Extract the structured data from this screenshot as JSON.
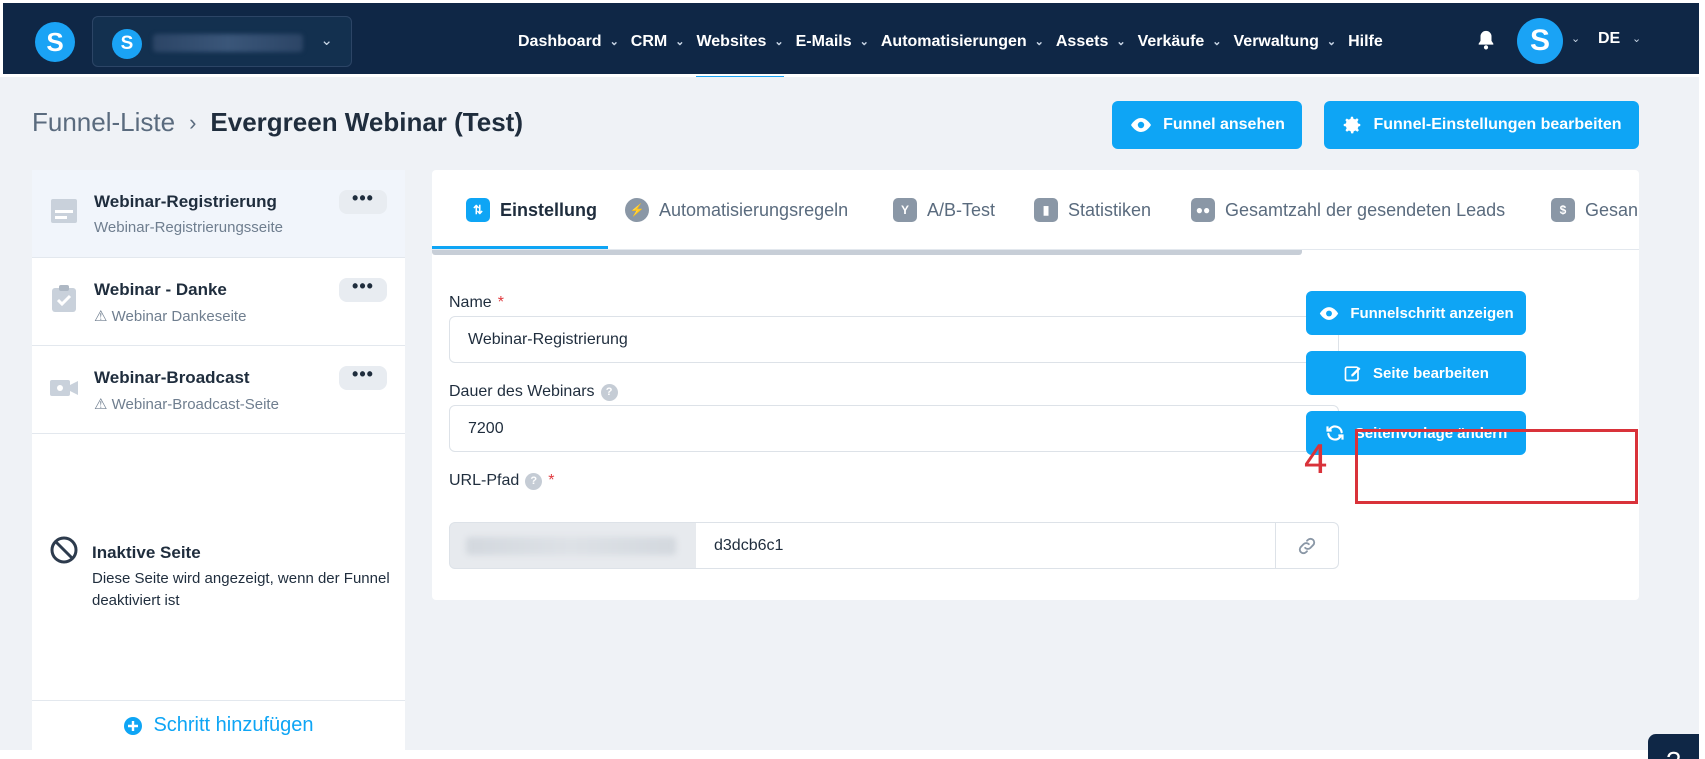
{
  "brand": {
    "logo_letter": "S",
    "accent": "#0ea5f5",
    "navbar_bg": "#0f2746"
  },
  "account_switcher": {
    "letter": "S"
  },
  "nav": {
    "items": [
      {
        "label": "Dashboard",
        "has_caret": true
      },
      {
        "label": "CRM",
        "has_caret": true
      },
      {
        "label": "Websites",
        "has_caret": true,
        "active": true
      },
      {
        "label": "E-Mails",
        "has_caret": true
      },
      {
        "label": "Automatisierungen",
        "has_caret": true
      },
      {
        "label": "Assets",
        "has_caret": true
      },
      {
        "label": "Verkäufe",
        "has_caret": true
      },
      {
        "label": "Verwaltung",
        "has_caret": true
      },
      {
        "label": "Hilfe",
        "has_caret": false
      }
    ],
    "avatar_letter": "S",
    "language": "DE",
    "caret": "⌄"
  },
  "breadcrumb": {
    "parent": "Funnel-Liste",
    "separator": "›",
    "current": "Evergreen Webinar (Test)"
  },
  "header_buttons": {
    "view_funnel": "Funnel ansehen",
    "edit_settings": "Funnel-Einstellungen bearbeiten"
  },
  "steps": [
    {
      "title": "Webinar-Registrierung",
      "subtitle": "Webinar-Registrierungsseite",
      "warning": false,
      "active": true,
      "more": "•••"
    },
    {
      "title": "Webinar - Danke",
      "subtitle": "Webinar Dankeseite",
      "warning": true,
      "active": false,
      "more": "•••"
    },
    {
      "title": "Webinar-Broadcast",
      "subtitle": "Webinar-Broadcast-Seite",
      "warning": true,
      "active": false,
      "more": "•••"
    }
  ],
  "inactive_page": {
    "title": "Inaktive Seite",
    "description": "Diese Seite wird angezeigt, wenn der Funnel deaktiviert ist"
  },
  "add_step": "Schritt hinzufügen",
  "tabs": [
    {
      "label": "Einstellung",
      "active": true
    },
    {
      "label": "Automatisierungsregeln",
      "active": false
    },
    {
      "label": "A/B-Test",
      "active": false
    },
    {
      "label": "Statistiken",
      "active": false
    },
    {
      "label": "Gesamtzahl der gesendeten Leads",
      "active": false
    },
    {
      "label": "Gesan",
      "active": false
    }
  ],
  "form": {
    "name_label": "Name",
    "name_value": "Webinar-Registrierung",
    "duration_label": "Dauer des Webinars",
    "duration_value": "7200",
    "url_label": "URL-Pfad",
    "url_value": "d3dcb6c1",
    "required_mark": "*",
    "help_mark": "?"
  },
  "actions": {
    "view_step": "Funnelschritt anzeigen",
    "edit_page": "Seite bearbeiten",
    "change_template": "Seitenvorlage ändern"
  },
  "annotation": {
    "number": "4",
    "color": "#d9323a"
  },
  "help_fab": "?"
}
